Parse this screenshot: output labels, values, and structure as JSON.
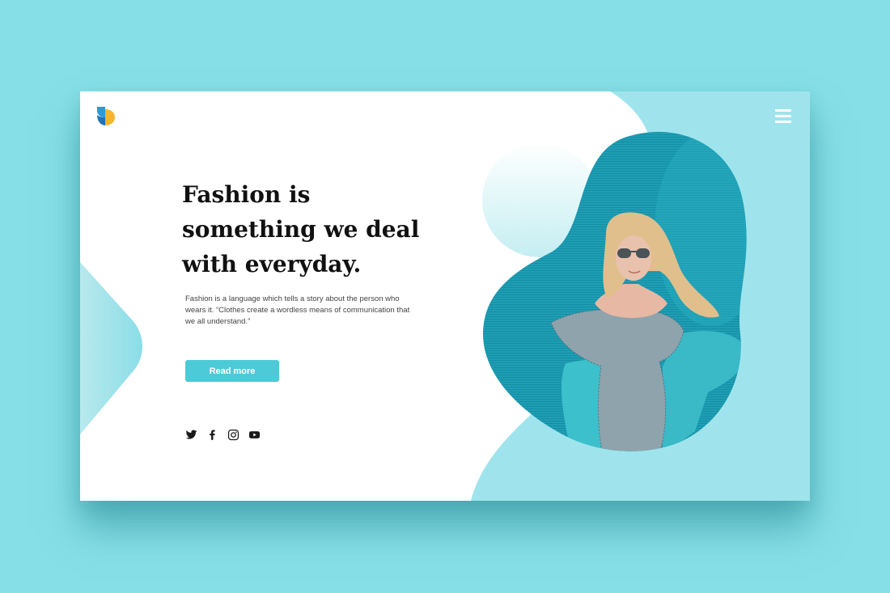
{
  "hero": {
    "headline": "Fashion is something we deal with everyday.",
    "description": "Fashion is a language which tells a story about the person who wears it. “Clothes create a wordless means of communication that we all understand.”",
    "cta_label": "Read more"
  },
  "header": {
    "logo_icon": "brand-logo-icon",
    "menu_icon": "hamburger-menu-icon"
  },
  "social": {
    "icons": [
      "twitter-icon",
      "facebook-icon",
      "instagram-icon",
      "youtube-icon"
    ]
  },
  "photo": {
    "subject": "blonde woman in sunglasses and gingham dress against teal wall"
  },
  "colors": {
    "page_background": "#86dfe7",
    "card_background": "#ffffff",
    "accent": "#4ccad8",
    "light_accent": "#9fe4ec",
    "photo_teal": "#1e9eb4",
    "headline_text": "#111111",
    "body_text": "#444444",
    "logo_blue": "#2a9ad8",
    "logo_yellow": "#f3b62f"
  }
}
